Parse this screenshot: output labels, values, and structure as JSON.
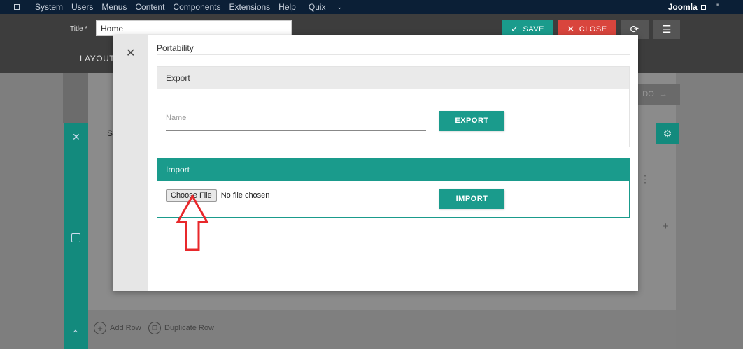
{
  "topbar": {
    "menu": [
      "System",
      "Users",
      "Menus",
      "Content",
      "Components",
      "Extensions",
      "Help"
    ],
    "quix_label": "Quix",
    "brand": "Joomla",
    "extra": "\""
  },
  "toolbar": {
    "title_label": "Title *",
    "title_value": "Home",
    "save_label": "SAVE",
    "close_label": "CLOSE",
    "layout_tab": "LAYOUT"
  },
  "builder": {
    "right_panel_text": "DO",
    "section_label": "S",
    "add_row_label": "Add Row",
    "duplicate_row_label": "Duplicate Row"
  },
  "modal": {
    "title": "Portability",
    "export": {
      "heading": "Export",
      "name_placeholder": "Name",
      "button_label": "EXPORT"
    },
    "import": {
      "heading": "Import",
      "choose_file_label": "Choose File",
      "no_file_text": "No file chosen",
      "button_label": "IMPORT"
    }
  },
  "colors": {
    "teal": "#1a9b8c",
    "danger": "#d9453d",
    "annotation_arrow": "#e8282b"
  },
  "annotation": {
    "icon": "arrow-up-outline-icon"
  }
}
